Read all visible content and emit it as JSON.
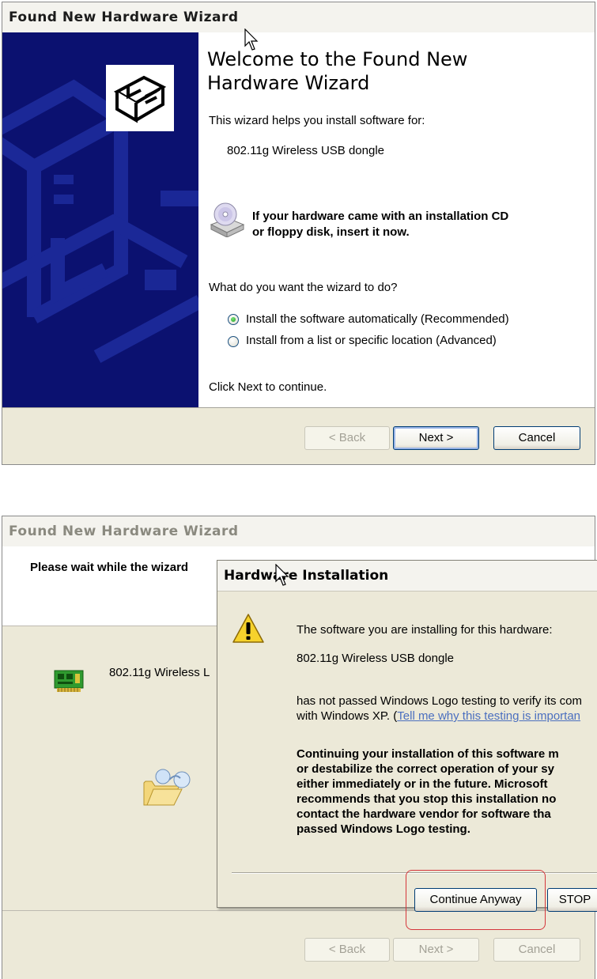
{
  "wizard1": {
    "title": "Found New Hardware Wizard",
    "welcome_line1": "Welcome to the Found New",
    "welcome_line2": "Hardware Wizard",
    "intro": "This wizard helps you install software for:",
    "device": "802.11g Wireless USB dongle",
    "cd_line1": "If your hardware came with an installation CD",
    "cd_line2": "or floppy disk, insert it now.",
    "question": "What do you want the wizard to do?",
    "options": [
      {
        "label": "Install the software automatically (Recommended)",
        "selected": true
      },
      {
        "label": "Install from a list or specific location (Advanced)",
        "selected": false
      }
    ],
    "continue_hint": "Click Next to continue.",
    "buttons": {
      "back": "< Back",
      "next": "Next >",
      "cancel": "Cancel"
    }
  },
  "wizard2": {
    "title": "Found New Hardware Wizard",
    "header_text": "Please wait while the wizard",
    "device_partial": "802.11g Wireless L",
    "buttons": {
      "back": "< Back",
      "next": "Next >",
      "cancel": "Cancel"
    }
  },
  "dialog": {
    "title": "Hardware Installation",
    "line1": "The software you are installing for this hardware:",
    "device": "802.11g Wireless USB dongle",
    "logo_line1": "has not passed Windows Logo testing to verify its com",
    "logo_line2_prefix": "with Windows XP. (",
    "logo_link": "Tell me why this testing is importan",
    "warning_lines": [
      "Continuing your installation of this software m",
      "or destabilize the correct operation of your sy",
      "either immediately or in the future. Microsoft",
      "recommends that you stop this installation no",
      "contact the hardware vendor for software tha",
      "passed Windows Logo testing."
    ],
    "buttons": {
      "continue": "Continue Anyway",
      "stop": "STOP"
    }
  },
  "colors": {
    "wizard_banner": "#0b1170",
    "dialog_face": "#ece9d8",
    "highlight_ring": "#d5363b",
    "link": "#4b6fbf"
  },
  "icons": [
    "hardware-wizard-icon",
    "cd-drive-icon",
    "warning-icon",
    "network-card-icon",
    "folder-search-icon",
    "mouse-cursor-icon"
  ]
}
